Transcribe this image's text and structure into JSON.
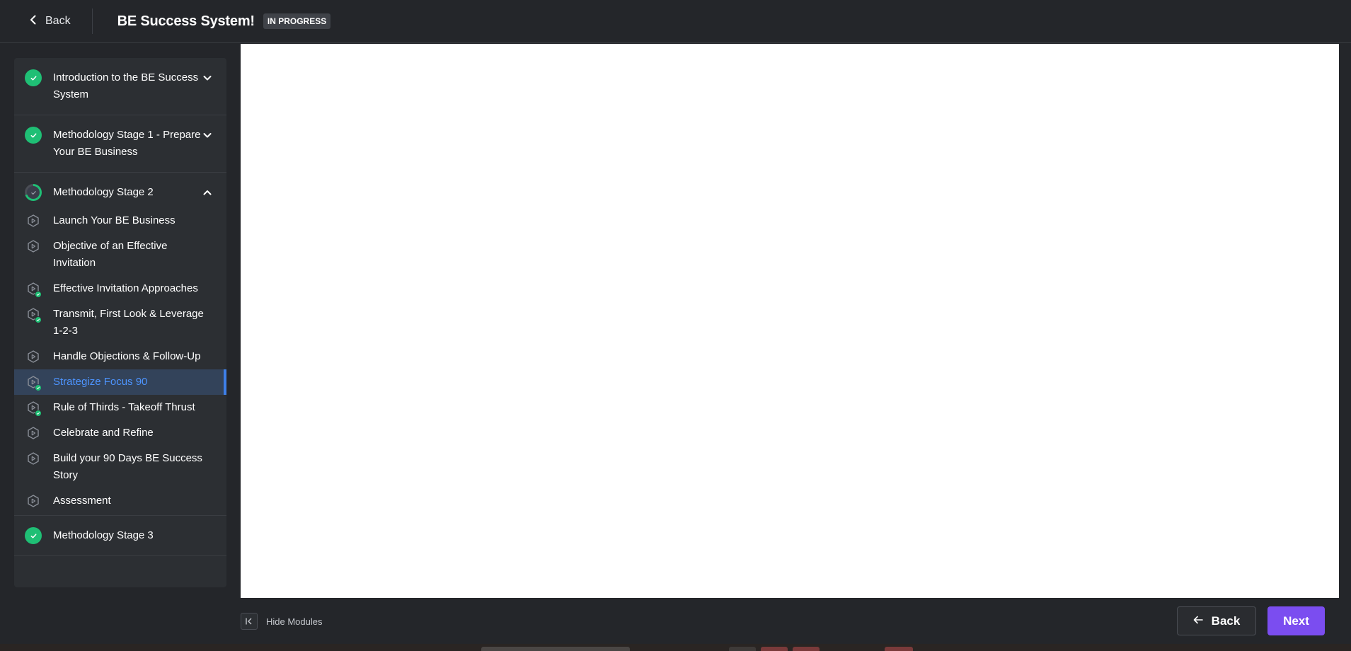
{
  "header": {
    "back_label": "Back",
    "title": "BE Success System!",
    "status_badge": "IN PROGRESS"
  },
  "sidebar": {
    "modules": [
      {
        "title": "Introduction to the BE Success System",
        "status": "complete",
        "expanded": false
      },
      {
        "title": "Methodology Stage 1 - Prepare Your BE Business",
        "status": "complete",
        "expanded": false
      },
      {
        "title": "Methodology Stage 2",
        "status": "in-progress",
        "expanded": true,
        "lessons": [
          {
            "title": "Launch Your BE Business",
            "completed": false
          },
          {
            "title": "Objective of an Effective Invitation",
            "completed": false
          },
          {
            "title": "Effective Invitation Approaches",
            "completed": true
          },
          {
            "title": "Transmit, First Look & Leverage 1-2-3",
            "completed": true
          },
          {
            "title": "Handle Objections & Follow-Up",
            "completed": false
          },
          {
            "title": "Strategize Focus 90",
            "completed": true,
            "active": true
          },
          {
            "title": "Rule of Thirds - Takeoff Thrust",
            "completed": true
          },
          {
            "title": "Celebrate and Refine",
            "completed": false
          },
          {
            "title": "Build your 90 Days BE Success Story",
            "completed": false
          },
          {
            "title": "Assessment",
            "completed": false
          }
        ]
      },
      {
        "title": "Methodology Stage 3",
        "status": "complete",
        "expanded": false
      }
    ]
  },
  "footer": {
    "hide_modules_label": "Hide Modules",
    "back_button": "Back",
    "next_button": "Next"
  },
  "colors": {
    "background": "#24262a",
    "sidebar": "#2c2f33",
    "complete": "#1fbf75",
    "active_accent": "#3e7fe8",
    "active_text": "#4d94ff",
    "next_button": "#7b4df0"
  }
}
